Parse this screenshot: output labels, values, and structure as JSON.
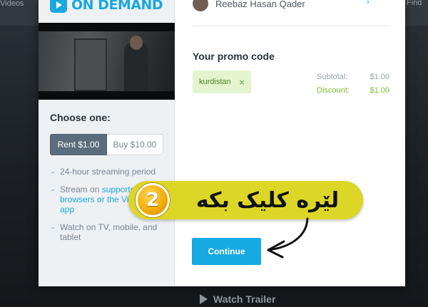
{
  "background": {
    "nav_left": "Videos",
    "nav_right": "Find",
    "watch_trailer": "Watch Trailer"
  },
  "left_panel": {
    "brand": "ON DEMAND",
    "choose_title": "Choose one:",
    "options": [
      {
        "label": "Rent $1.00",
        "selected": true
      },
      {
        "label": "Buy $10.00",
        "selected": false
      }
    ],
    "features": [
      {
        "text": "24-hour streaming period"
      },
      {
        "text_before": "Stream on ",
        "link": "supported browsers or the Vi",
        "text_after": "",
        "link2": "mobile app"
      },
      {
        "text": "Watch on TV, mobile, and tablet"
      }
    ]
  },
  "user": {
    "name": "Reebaz Hasan Qader"
  },
  "promo": {
    "title": "Your promo code",
    "code": "kurdistan",
    "remove_symbol": "×"
  },
  "totals": {
    "subtotal_label": "Subtotal:",
    "subtotal_value": "$1.00",
    "discount_label": "Discount:",
    "discount_value": "$1.00"
  },
  "continue_label": "Continue",
  "annotation": {
    "step_number": "2",
    "text": "لێرە کلیک بکە"
  },
  "colors": {
    "accent": "#1aa8e0",
    "discount_green": "#7fbb2e",
    "annotation_yellow": "#dcd626",
    "selected_option": "#5b6d7c"
  }
}
